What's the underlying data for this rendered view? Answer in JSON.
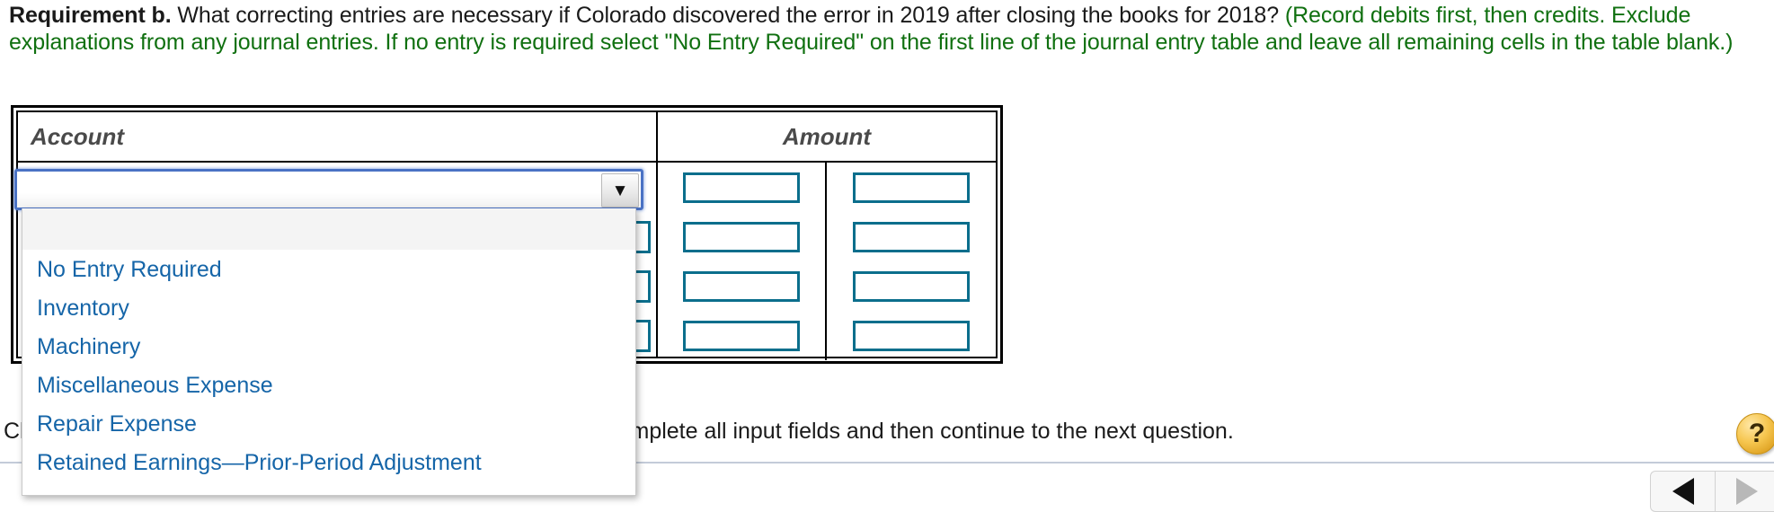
{
  "prompt": {
    "requirement_label": "Requirement b.",
    "question": " What correcting entries are necessary if Colorado discovered the error in 2019 after closing the books for 2018? ",
    "instructions_green": "(Record debits first, then credits. Exclude explanations from any journal entries. If no entry is required select \"No Entry Required\" on the first line of the journal entry table and leave all remaining cells in the table blank.)",
    "green_color": "#107010"
  },
  "table": {
    "headers": {
      "account": "Account",
      "amount": "Amount"
    },
    "rows": [
      {
        "account_value": "",
        "debit_value": "",
        "credit_value": ""
      },
      {
        "account_value": "",
        "debit_value": "",
        "credit_value": ""
      },
      {
        "account_value": "",
        "debit_value": "",
        "credit_value": ""
      },
      {
        "account_value": "",
        "debit_value": "",
        "credit_value": ""
      }
    ],
    "input_border_color": "#0b6e8c"
  },
  "account_select": {
    "selected_value": "",
    "placeholder": "",
    "arrow_glyph": "▼",
    "focus_ring_color": "#4a72c4",
    "is_open": true,
    "options": [
      "",
      "No Entry Required",
      "Inventory",
      "Machinery",
      "Miscellaneous Expense",
      "Repair Expense",
      "Retained Earnings—Prior-Period Adjustment"
    ],
    "option_color": "#1565a8"
  },
  "footer": {
    "instruction": "Click to select your answer(s) and then click Check Answer. Complete all input fields and then continue to the next question.",
    "help_icon_label": "?",
    "nav": {
      "previous_label": "◀",
      "next_label": "▶",
      "previous_enabled": true,
      "next_enabled": false
    }
  }
}
